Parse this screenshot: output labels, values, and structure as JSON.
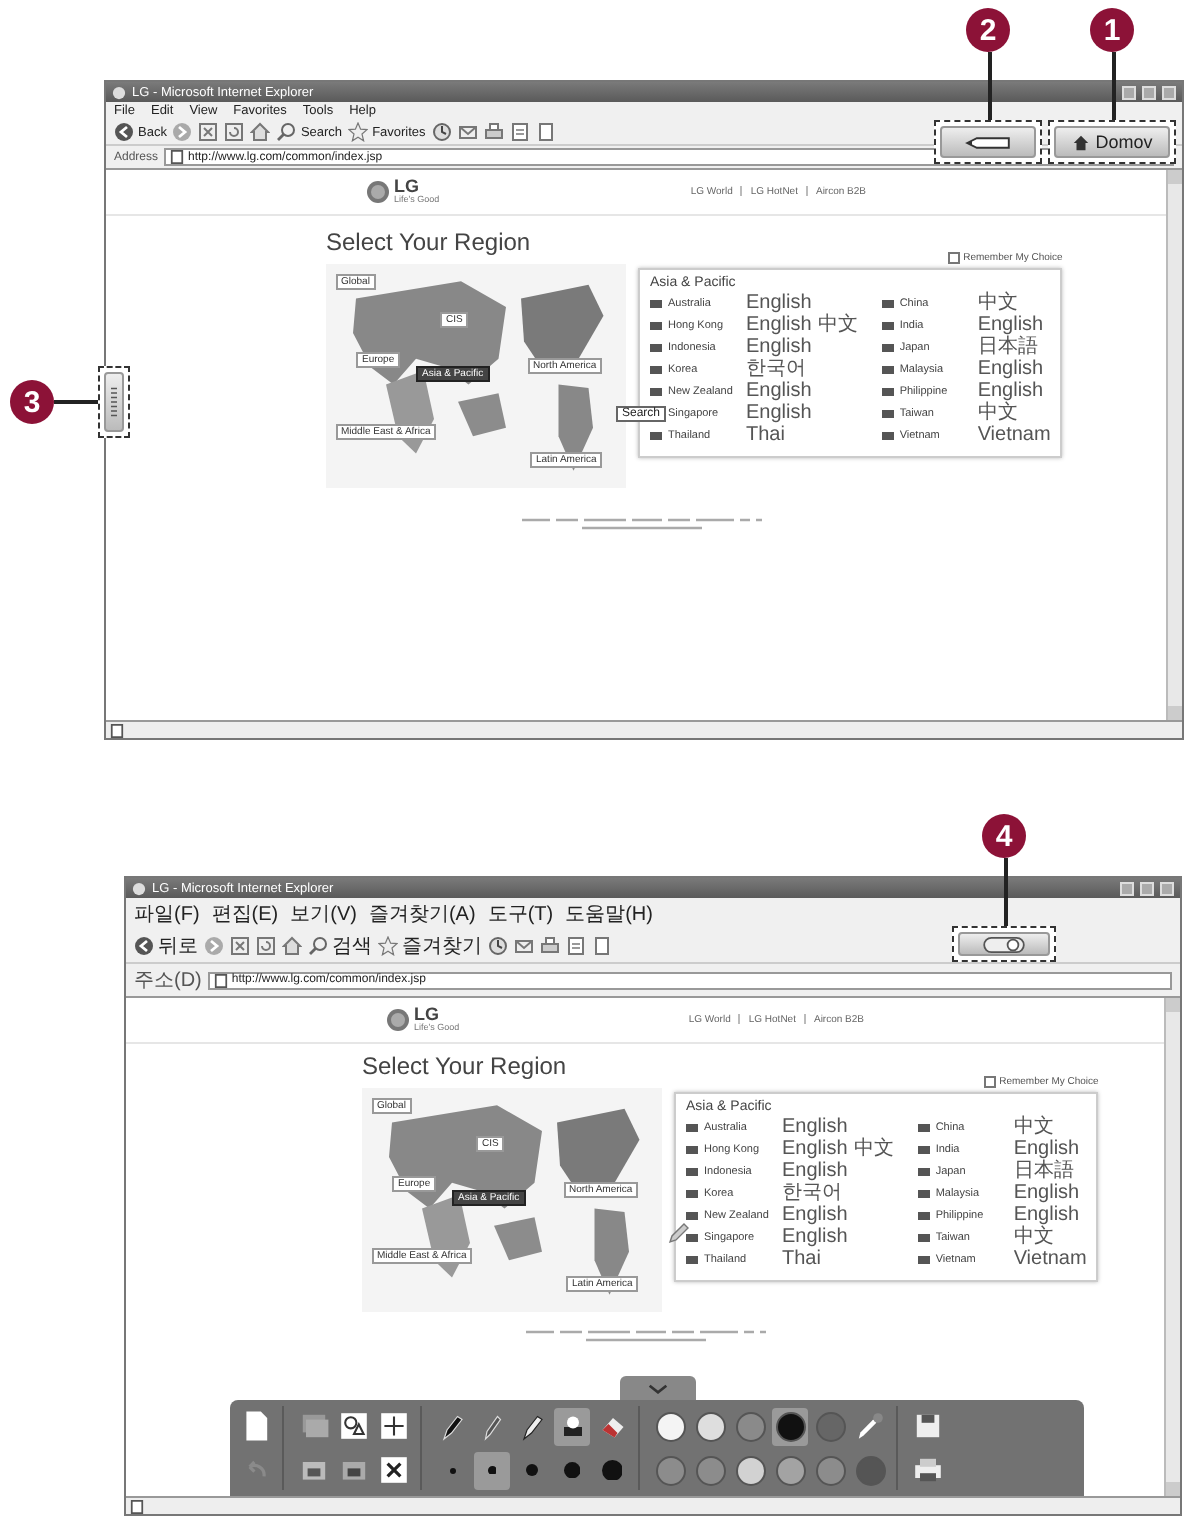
{
  "screenshots": [
    {
      "window_title": "LG - Microsoft Internet Explorer",
      "menu": [
        "File",
        "Edit",
        "View",
        "Favorites",
        "Tools",
        "Help"
      ],
      "toolbar": {
        "back": "Back",
        "search": "Search",
        "favorites": "Favorites"
      },
      "address_label": "Address",
      "address": "http://www.lg.com/common/index.jsp",
      "site": {
        "logo": "LG",
        "tagline": "Life's Good",
        "top_links": [
          "LG World",
          "LG HotNet",
          "Aircon B2B"
        ],
        "heading": "Select Your Region",
        "remember": "Remember My Choice",
        "remember_checked": false,
        "map_labels": [
          {
            "label": "Global",
            "selected": false
          },
          {
            "label": "CIS",
            "selected": false
          },
          {
            "label": "Europe",
            "selected": false
          },
          {
            "label": "Asia & Pacific",
            "selected": true
          },
          {
            "label": "North America",
            "selected": false
          },
          {
            "label": "Middle East & Africa",
            "selected": false
          },
          {
            "label": "Latin America",
            "selected": false
          }
        ],
        "cursor": {
          "kind": "hand",
          "tooltip": "Search"
        },
        "panel": {
          "title": "Asia & Pacific",
          "columns": [
            [
              {
                "name": "Australia",
                "languages": [
                  "English"
                ]
              },
              {
                "name": "Hong Kong",
                "languages": [
                  "English",
                  "中文"
                ]
              },
              {
                "name": "Indonesia",
                "languages": [
                  "English"
                ]
              },
              {
                "name": "Korea",
                "languages": [
                  "한국어"
                ]
              },
              {
                "name": "New Zealand",
                "languages": [
                  "English"
                ]
              },
              {
                "name": "Singapore",
                "languages": [
                  "English"
                ]
              },
              {
                "name": "Thailand",
                "languages": [
                  "Thai"
                ]
              }
            ],
            [
              {
                "name": "China",
                "languages": [
                  "中文"
                ]
              },
              {
                "name": "India",
                "languages": [
                  "English"
                ]
              },
              {
                "name": "Japan",
                "languages": [
                  "日本語"
                ]
              },
              {
                "name": "Malaysia",
                "languages": [
                  "English"
                ]
              },
              {
                "name": "Philippine",
                "languages": [
                  "English"
                ]
              },
              {
                "name": "Taiwan",
                "languages": [
                  "中文"
                ]
              },
              {
                "name": "Vietnam",
                "languages": [
                  "Vietnam"
                ]
              }
            ]
          ]
        }
      },
      "overlays": [
        {
          "kind": "pen",
          "callout": "2"
        },
        {
          "kind": "home",
          "label": "Domov",
          "callout": "1"
        },
        {
          "kind": "handle",
          "callout": "3"
        }
      ]
    },
    {
      "window_title": "LG - Microsoft Internet Explorer",
      "menu": [
        "파일(F)",
        "편집(E)",
        "보기(V)",
        "즐겨찾기(A)",
        "도구(T)",
        "도움말(H)"
      ],
      "toolbar": {
        "back": "뒤로",
        "search": "검색",
        "favorites": "즐겨찾기"
      },
      "address_label": "주소(D)",
      "address": "http://www.lg.com/common/index.jsp",
      "site": {
        "logo": "LG",
        "tagline": "Life's Good",
        "top_links": [
          "LG World",
          "LG HotNet",
          "Aircon B2B"
        ],
        "heading": "Select Your Region",
        "remember": "Remember My Choice",
        "remember_checked": false,
        "map_labels": [
          {
            "label": "Global",
            "selected": false
          },
          {
            "label": "CIS",
            "selected": false
          },
          {
            "label": "Europe",
            "selected": false
          },
          {
            "label": "Asia & Pacific",
            "selected": true
          },
          {
            "label": "North America",
            "selected": false
          },
          {
            "label": "Middle East & Africa",
            "selected": false
          },
          {
            "label": "Latin America",
            "selected": false
          }
        ],
        "cursor": {
          "kind": "pen"
        },
        "panel": {
          "title": "Asia & Pacific",
          "columns": [
            [
              {
                "name": "Australia",
                "languages": [
                  "English"
                ]
              },
              {
                "name": "Hong Kong",
                "languages": [
                  "English",
                  "中文"
                ]
              },
              {
                "name": "Indonesia",
                "languages": [
                  "English"
                ]
              },
              {
                "name": "Korea",
                "languages": [
                  "한국어"
                ]
              },
              {
                "name": "New Zealand",
                "languages": [
                  "English"
                ]
              },
              {
                "name": "Singapore",
                "languages": [
                  "English"
                ]
              },
              {
                "name": "Thailand",
                "languages": [
                  "Thai"
                ]
              }
            ],
            [
              {
                "name": "China",
                "languages": [
                  "中文"
                ]
              },
              {
                "name": "India",
                "languages": [
                  "English"
                ]
              },
              {
                "name": "Japan",
                "languages": [
                  "日本語"
                ]
              },
              {
                "name": "Malaysia",
                "languages": [
                  "English"
                ]
              },
              {
                "name": "Philippine",
                "languages": [
                  "English"
                ]
              },
              {
                "name": "Taiwan",
                "languages": [
                  "中文"
                ]
              },
              {
                "name": "Vietnam",
                "languages": [
                  "Vietnam"
                ]
              }
            ]
          ]
        }
      },
      "overlays": [
        {
          "kind": "toggle",
          "callout": "4"
        }
      ],
      "drawing_toolbar": {
        "pens": [
          {
            "kind": "marker",
            "selected": false
          },
          {
            "kind": "pencil",
            "selected": false
          },
          {
            "kind": "highlighter",
            "selected": false
          },
          {
            "kind": "bucket",
            "selected": true
          },
          {
            "kind": "eraser",
            "selected": false
          }
        ],
        "sizes": [
          {
            "selected": false
          },
          {
            "selected": true
          },
          {
            "selected": false
          },
          {
            "selected": false
          },
          {
            "selected": false
          }
        ],
        "colors_top": [
          {
            "color": "#f4f4f4",
            "selected": false
          },
          {
            "color": "#dedede",
            "selected": false
          },
          {
            "color": "#8a8a8a",
            "selected": false
          },
          {
            "color": "#111111",
            "selected": true
          },
          {
            "color": "#666666",
            "selected": false
          }
        ],
        "colors_bottom": [
          {
            "color": "#8c8c8c",
            "selected": false
          },
          {
            "color": "#8c8c8c",
            "selected": false
          },
          {
            "color": "#d2d2d2",
            "selected": false
          },
          {
            "color": "#a3a3a3",
            "selected": false
          },
          {
            "color": "#8c8c8c",
            "selected": false
          },
          {
            "color": "#555555",
            "selected": false
          }
        ]
      }
    }
  ]
}
